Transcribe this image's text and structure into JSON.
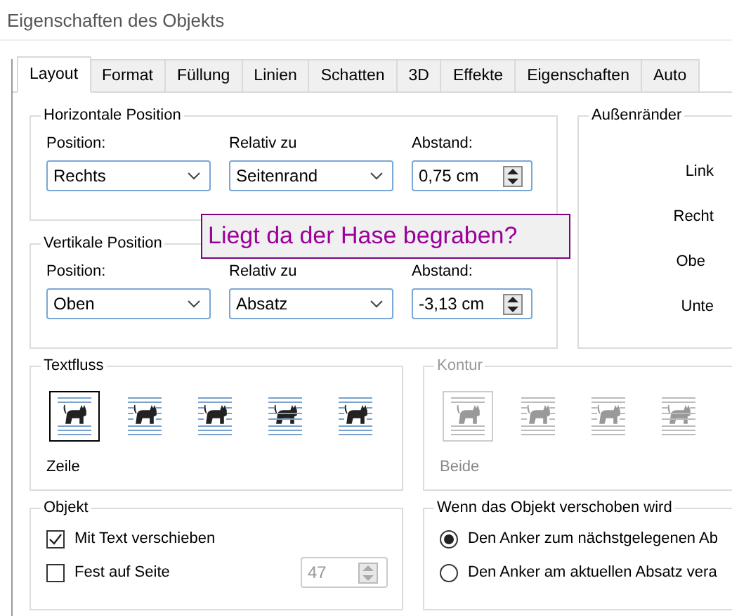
{
  "window": {
    "title": "Eigenschaften des Objekts"
  },
  "tabs": [
    {
      "label": "Layout",
      "selected": true
    },
    {
      "label": "Format",
      "selected": false
    },
    {
      "label": "Füllung",
      "selected": false
    },
    {
      "label": "Linien",
      "selected": false
    },
    {
      "label": "Schatten",
      "selected": false
    },
    {
      "label": "3D",
      "selected": false
    },
    {
      "label": "Effekte",
      "selected": false
    },
    {
      "label": "Eigenschaften",
      "selected": false
    },
    {
      "label": "Auto",
      "selected": false
    }
  ],
  "horizontal": {
    "title": "Horizontale Position",
    "fields": [
      {
        "label": "Position:",
        "value": "Rechts",
        "kind": "select"
      },
      {
        "label": "Relativ zu",
        "value": "Seitenrand",
        "kind": "select"
      },
      {
        "label": "Abstand:",
        "value": "0,75 cm",
        "kind": "spin"
      }
    ]
  },
  "vertical": {
    "title": "Vertikale Position",
    "fields": [
      {
        "label": "Position:",
        "value": "Oben",
        "kind": "select"
      },
      {
        "label": "Relativ zu",
        "value": "Absatz",
        "kind": "select"
      },
      {
        "label": "Abstand:",
        "value": "-3,13 cm",
        "kind": "spin"
      }
    ]
  },
  "margins": {
    "title": "Außenränder",
    "labels": [
      "Link",
      "Recht",
      "Obe",
      "Unte"
    ]
  },
  "callout": {
    "text": "Liegt da der Hase begraben?"
  },
  "text_flow": {
    "title": "Textfluss",
    "disabled": false,
    "options": [
      {
        "selected": true
      },
      {
        "selected": false
      },
      {
        "selected": false
      },
      {
        "selected": false
      },
      {
        "selected": false
      }
    ],
    "caption": "Zeile"
  },
  "contour": {
    "title": "Kontur",
    "disabled": true,
    "options": [
      {
        "selected": true
      },
      {
        "selected": false
      },
      {
        "selected": false
      },
      {
        "selected": false
      }
    ],
    "caption": "Beide"
  },
  "object": {
    "title": "Objekt",
    "options": [
      {
        "label": "Mit Text verschieben",
        "checked": true
      },
      {
        "label": "Fest auf Seite",
        "checked": false
      }
    ],
    "page_field": {
      "value": "47",
      "disabled": true
    }
  },
  "anchor": {
    "title": "Wenn das Objekt verschoben wird",
    "options": [
      {
        "label": "Den Anker zum nächstgelegenen Ab",
        "selected": true
      },
      {
        "label": "Den Anker am aktuellen Absatz vera",
        "selected": false
      }
    ]
  }
}
